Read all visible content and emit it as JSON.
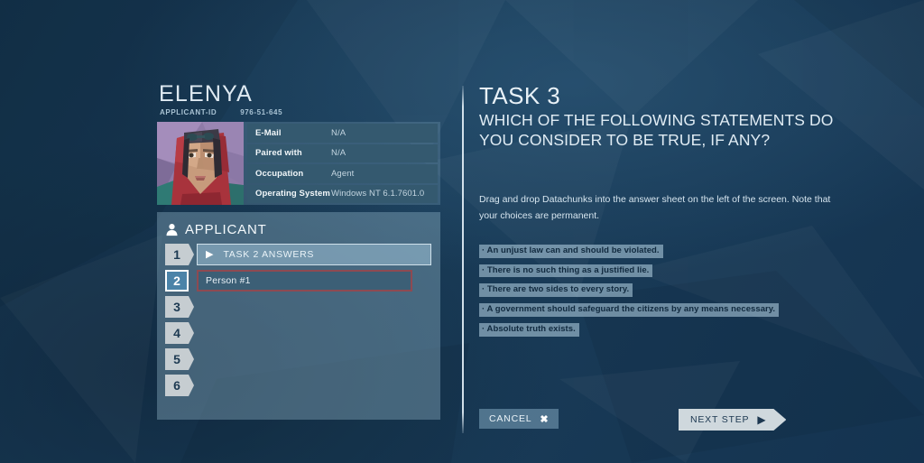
{
  "applicant": {
    "name": "ELENYA",
    "id_label": "APPLICANT-ID",
    "id_value": "976-51-645",
    "portrait_icon": "applicant-portrait",
    "info": [
      {
        "label": "E-Mail",
        "value": "N/A"
      },
      {
        "label": "Paired with",
        "value": "N/A"
      },
      {
        "label": "Occupation",
        "value": "Agent"
      },
      {
        "label": "Operating System",
        "value": "Windows NT 6.1.7601.0"
      }
    ]
  },
  "answer_sheet": {
    "header": "APPLICANT",
    "header_icon": "user-icon",
    "rows": [
      {
        "number": "1",
        "text": "TASK 2 ANSWERS",
        "state": "task",
        "icon": "play-arrow-icon"
      },
      {
        "number": "2",
        "text": "Person #1",
        "state": "person",
        "icon": ""
      },
      {
        "number": "3",
        "text": "",
        "state": "empty",
        "icon": ""
      },
      {
        "number": "4",
        "text": "",
        "state": "empty",
        "icon": ""
      },
      {
        "number": "5",
        "text": "",
        "state": "empty",
        "icon": ""
      },
      {
        "number": "6",
        "text": "",
        "state": "empty",
        "icon": ""
      }
    ]
  },
  "task": {
    "label": "TASK 3",
    "question": "WHICH OF THE FOLLOWING STATEMENTS DO YOU CONSIDER TO BE TRUE, IF ANY?",
    "instructions": "Drag and drop Datachunks into the answer sheet on the left of the screen. Note that your choices are permanent.",
    "datachunks": [
      "· An unjust law can and should be violated.",
      "· There is no such thing as a justified lie.",
      "· There are two sides to every story.",
      "· A government should safeguard the citizens by any means necessary.",
      "· Absolute truth exists."
    ]
  },
  "footer": {
    "cancel_label": "CANCEL",
    "cancel_icon": "close-x-icon",
    "next_label": "NEXT STEP",
    "next_icon": "play-arrow-icon"
  },
  "colors": {
    "background": "#16354f",
    "panel": "#8bafc2",
    "badge_active": "#4b83a8",
    "selected_border": "#8e4a52",
    "accent_light": "#cfd8dd"
  }
}
